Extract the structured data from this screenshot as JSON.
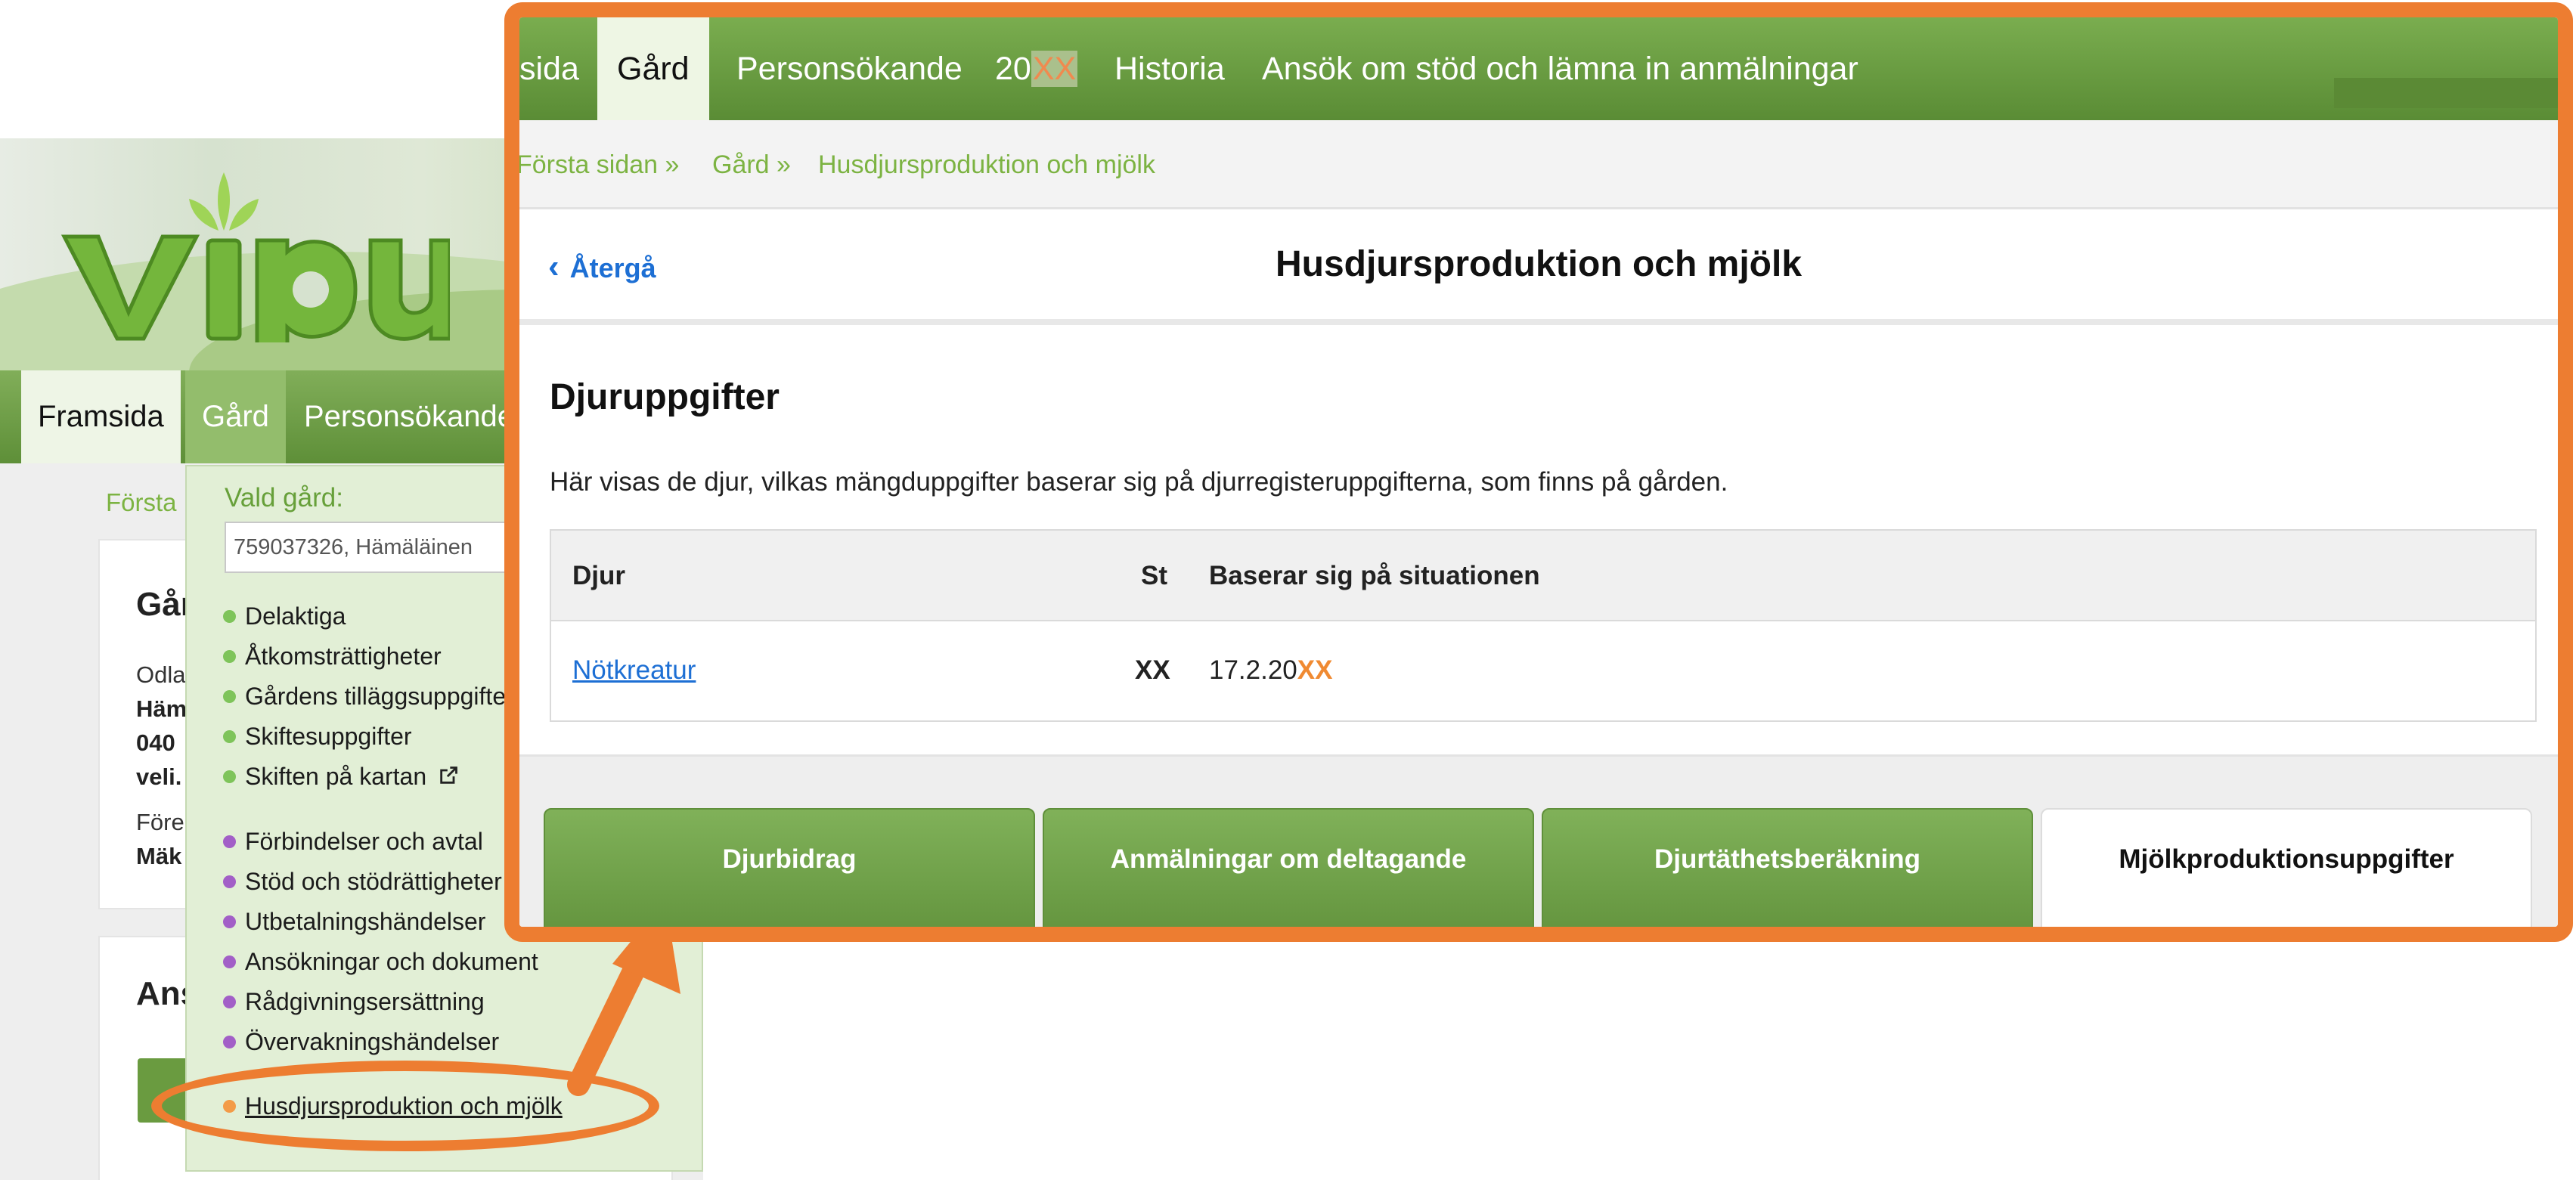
{
  "background_page": {
    "nav": {
      "home": "Framsida",
      "farm": "Gård",
      "person": "Personsökande"
    },
    "breadcrumb_first": "Första",
    "card1": {
      "title": "Går",
      "line1": "Odla",
      "line2": "Häm",
      "line3": "040",
      "line4": "veli.",
      "line5": "Före",
      "line6": "Mäk"
    },
    "card2": {
      "title": "Ans"
    },
    "farm_menu": {
      "label": "Vald gård:",
      "selected_farm": "759037326, Hämäläinen",
      "items_group1": [
        "Delaktiga",
        "Åtkomsträttigheter",
        "Gårdens tilläggsuppgifter",
        "Skiftesuppgifter",
        "Skiften på kartan"
      ],
      "items_group2": [
        "Förbindelser och avtal",
        "Stöd och stödrättigheter",
        "Utbetalningshändelser",
        "Ansökningar och dokument",
        "Rådgivningsersättning",
        "Övervakningshändelser"
      ],
      "highlighted_item": "Husdjursproduktion och mjölk"
    }
  },
  "zoom": {
    "nav": {
      "partial": "sida",
      "farm": "Gård",
      "person": "Personsökande",
      "year_prefix": "20",
      "year_masked": "XX",
      "history": "Historia",
      "apply": "Ansök om stöd och lämna in anmälningar"
    },
    "breadcrumb": [
      "Första sidan »",
      "Gård »",
      "Husdjursproduktion och mjölk"
    ],
    "back_label": "Återgå",
    "page_title": "Husdjursproduktion och mjölk",
    "section_title": "Djuruppgifter",
    "intro_text": "Här visas de djur, vilkas mängduppgifter baserar sig på djurregisteruppgifterna, som finns på gården.",
    "table": {
      "headers": [
        "Djur",
        "St",
        "Baserar sig på situationen"
      ],
      "rows": [
        {
          "animal": "Nötkreatur",
          "count": "XX",
          "date_prefix": "17.2.20",
          "date_masked": "XX"
        }
      ]
    },
    "tabs": [
      "Djurbidrag",
      "Anmälningar om deltagande",
      "Djurtäthetsberäkning",
      "Mjölkproduktionsuppgifter"
    ],
    "active_tab": "Mjölkproduktionsuppgifter"
  },
  "colors": {
    "annotation": "#ed7d31",
    "nav_green": "#6a9d42",
    "link_blue": "#1d6fd4",
    "breadcrumb_green": "#7cb342"
  },
  "icons": [
    "external-link-icon",
    "chevron-left-icon",
    "vipu-logo"
  ]
}
